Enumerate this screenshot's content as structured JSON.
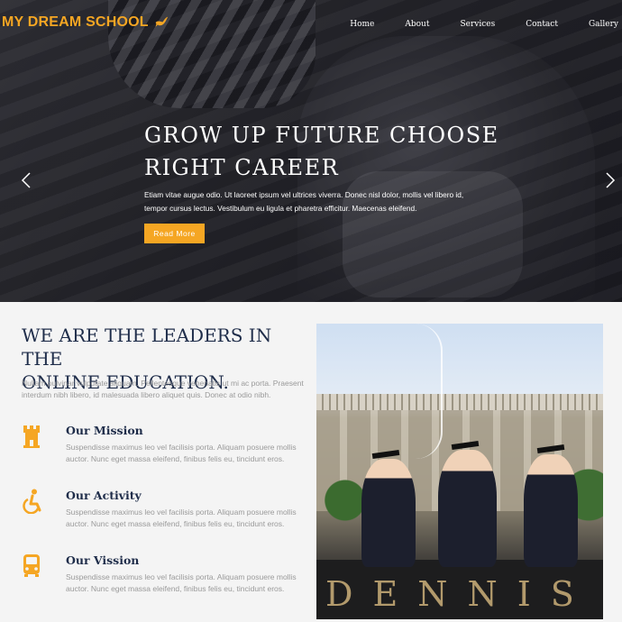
{
  "brand": {
    "name": "MY DREAM SCHOOL",
    "logo_icon": "bird-icon",
    "accent_color": "#f5a623",
    "title_color": "#1f2d4a"
  },
  "nav": {
    "items": [
      "Home",
      "About",
      "Services",
      "Contact",
      "Gallery"
    ]
  },
  "hero": {
    "title_line1": "GROW UP FUTURE CHOOSE",
    "title_line2": "RIGHT CAREER",
    "text_line1": "Etiam vitae augue odio. Ut laoreet ipsum vel ultrices viverra. Donec nisl dolor, mollis vel libero id,",
    "text_line2": "tempor cursus lectus. Vestibulum eu ligula et pharetra efficitur. Maecenas eleifend.",
    "button_label": "Read More",
    "prev_icon": "chevron-left-icon",
    "next_icon": "chevron-right-icon"
  },
  "about": {
    "title_line1": "WE ARE THE LEADERS IN THE",
    "title_line2": "ONLINE EDUCATION.",
    "text": "Nullam pulvinar vulputate aliquam. Pellentesque venenatis ut mi ac porta. Praesent interdum nibh libero, id malesuada libero aliquet quis. Donec at odio nibh.",
    "features": [
      {
        "icon": "castle-tower-icon",
        "title": "Our Mission",
        "text": "Suspendisse maximus leo vel facilisis porta. Aliquam posuere mollis auctor. Nunc eget massa eleifend, finibus felis eu, tincidunt eros."
      },
      {
        "icon": "wheelchair-icon",
        "title": "Our Activity",
        "text": "Suspendisse maximus leo vel facilisis porta. Aliquam posuere mollis auctor. Nunc eget massa eleifend, finibus felis eu, tincidunt eros."
      },
      {
        "icon": "bus-icon",
        "title": "Our Vission",
        "text": "Suspendisse maximus leo vel facilisis porta. Aliquam posuere mollis auctor. Nunc eget massa eleifend, finibus felis eu, tincidunt eros."
      }
    ]
  },
  "photo": {
    "wall_text": "DENNIS"
  }
}
